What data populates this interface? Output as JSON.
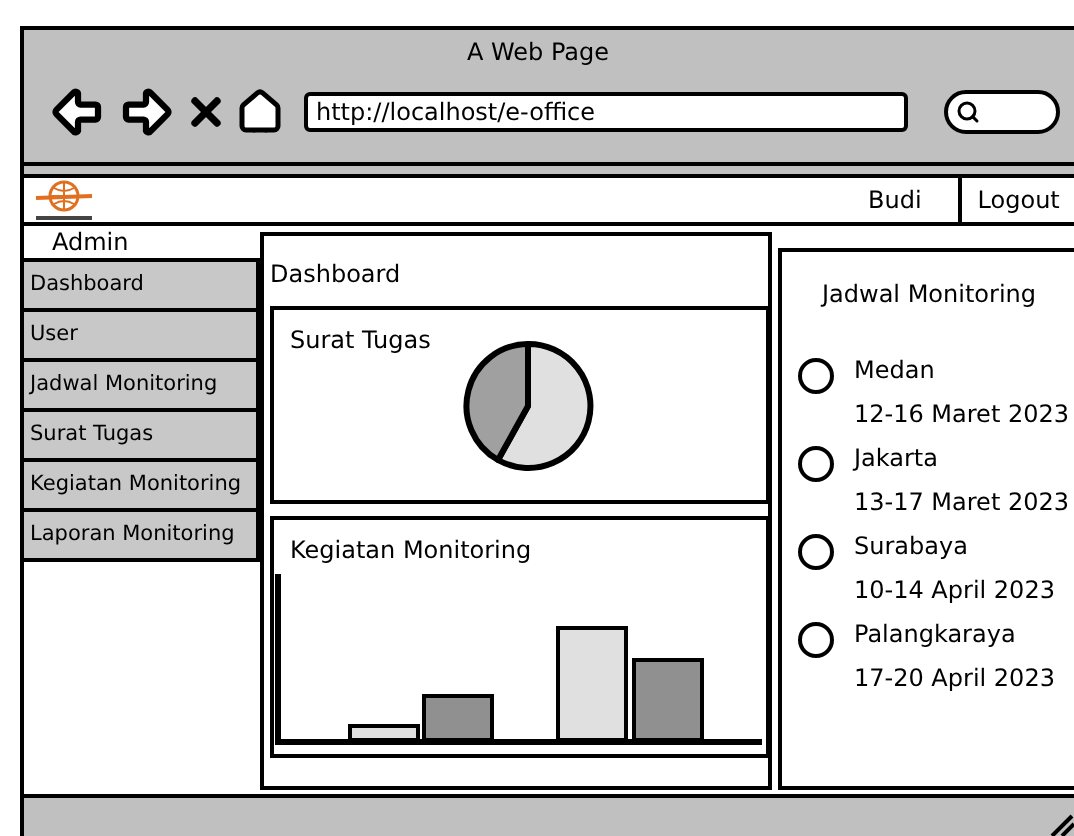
{
  "window": {
    "title": "A Web Page"
  },
  "address_bar": {
    "value": "http://localhost/e-office"
  },
  "header": {
    "user": "Budi",
    "logout": "Logout"
  },
  "sidebar": {
    "title": "Admin",
    "items": [
      {
        "label": "Dashboard",
        "selected": false
      },
      {
        "label": "User",
        "selected": false
      },
      {
        "label": "Jadwal Monitoring",
        "selected": false
      },
      {
        "label": "Surat Tugas",
        "selected": false
      },
      {
        "label": "Kegiatan Monitoring",
        "selected": false
      },
      {
        "label": "Laporan Monitoring",
        "selected": false
      }
    ]
  },
  "main": {
    "title": "Dashboard",
    "cards": [
      {
        "title": "Surat Tugas",
        "kind": "pie"
      },
      {
        "title": "Kegiatan Monitoring",
        "kind": "bar"
      }
    ]
  },
  "schedule": {
    "title": "Jadwal Monitoring",
    "items": [
      {
        "city": "Medan",
        "dates": "12-16 Maret 2023",
        "selected": false
      },
      {
        "city": "Jakarta",
        "dates": "13-17 Maret 2023",
        "selected": false
      },
      {
        "city": "Surabaya",
        "dates": "10-14 April 2023",
        "selected": false
      },
      {
        "city": "Palangkaraya",
        "dates": "17-20 April 2023",
        "selected": false
      }
    ]
  }
}
